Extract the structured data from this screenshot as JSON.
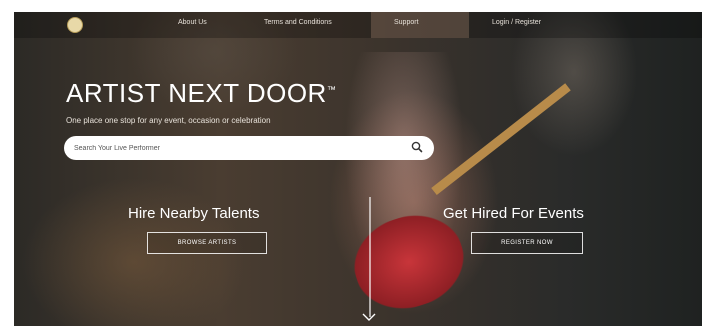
{
  "nav": {
    "items": [
      {
        "label": "About Us"
      },
      {
        "label": "Terms and Conditions"
      },
      {
        "label": "Support"
      },
      {
        "label": "Login / Register"
      }
    ]
  },
  "hero": {
    "title": "ARTIST NEXT DOOR",
    "trademark": "™",
    "tagline": "One place one stop for any event, occasion or celebration",
    "search": {
      "placeholder": "Search Your Live Performer"
    },
    "hire": {
      "title": "Hire Nearby Talents",
      "button": "BROWSE ARTISTS"
    },
    "get_hired": {
      "title": "Get Hired For Events",
      "button": "REGISTER NOW"
    }
  },
  "icons": {
    "logo": "logo-icon",
    "search": "search-icon",
    "scroll": "chevron-down-icon"
  }
}
